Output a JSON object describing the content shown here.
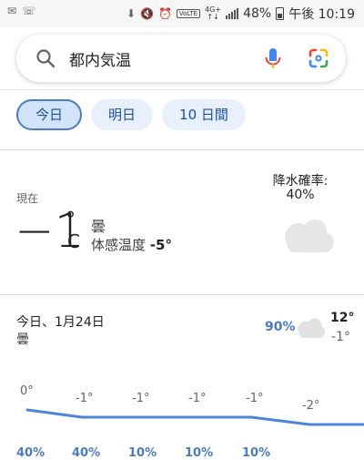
{
  "status_bar": {
    "network_top": "4G+",
    "network_bottom": "↑↓",
    "volte": "VoLTE",
    "battery": "48%",
    "clock": "午後 10:19"
  },
  "search": {
    "query": "都内気温"
  },
  "chips": [
    {
      "label": "今日"
    },
    {
      "label": "明日"
    },
    {
      "label": "10 日間"
    }
  ],
  "current": {
    "now_label": "現在",
    "temperature": "−1",
    "unit_degree": "°",
    "unit_c": "C",
    "condition": "曇",
    "feels_label": "体感温度 ",
    "feels_value": "-5°",
    "precip_label": "降水確率:",
    "precip_value": "40%"
  },
  "daily": {
    "title": "今日、1月24日",
    "condition": "曇",
    "precip": "90%",
    "high": "12°",
    "low": "-1°"
  },
  "hourly": {
    "temps": [
      "0°",
      "-1°",
      "-1°",
      "-1°",
      "-1°",
      "-2°"
    ],
    "temp_values": [
      0,
      -1,
      -1,
      -1,
      -1,
      -2,
      -2
    ],
    "precip": [
      "40%",
      "40%",
      "10%",
      "10%",
      "10%"
    ]
  },
  "colors": {
    "accent_blue": "#4a7cc3",
    "chip_bg": "#e8f0fe",
    "line_blue": "#4a86d9"
  }
}
